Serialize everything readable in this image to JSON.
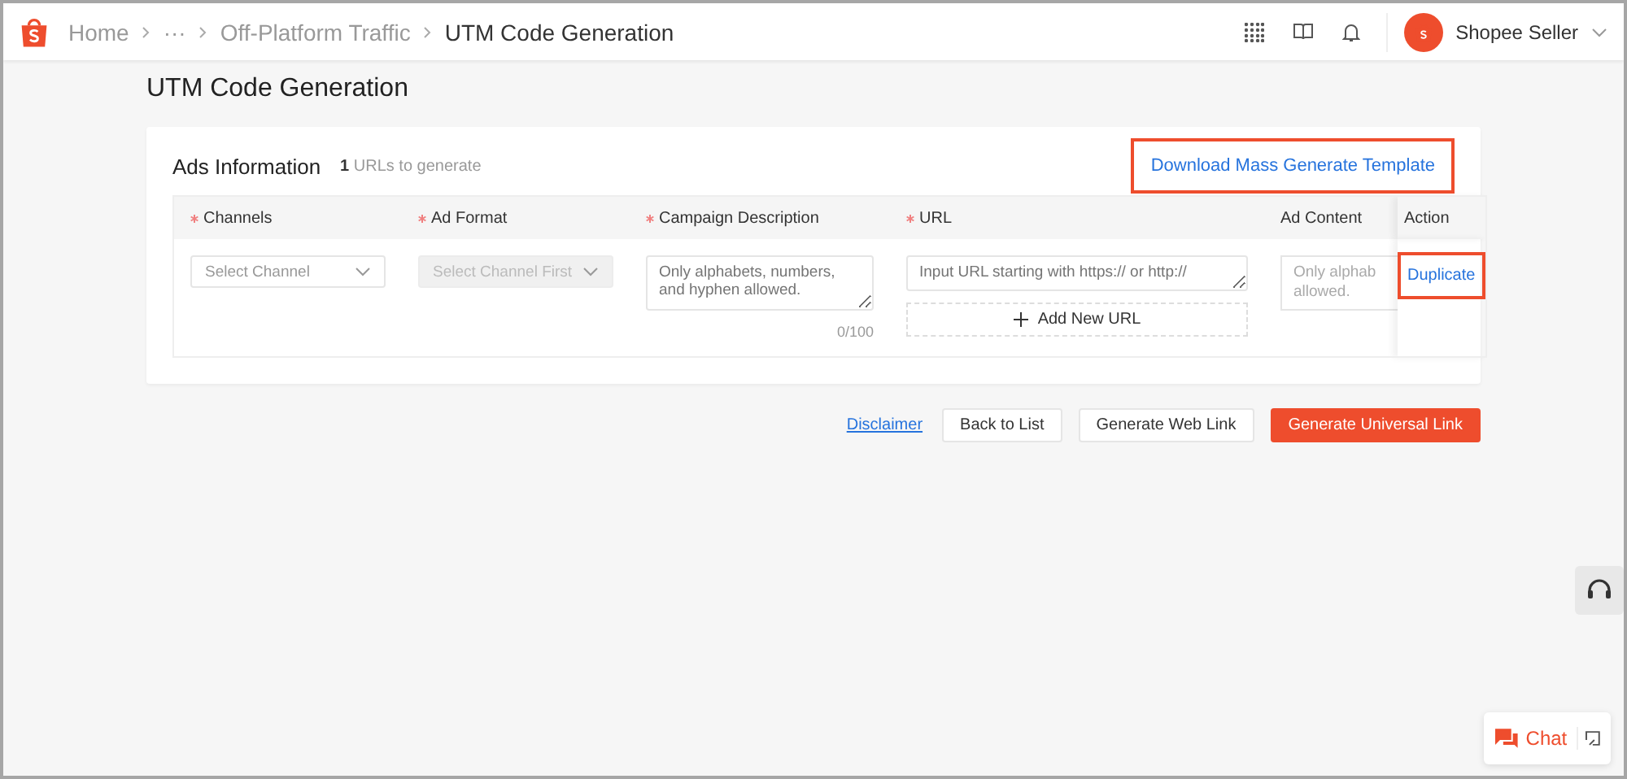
{
  "breadcrumb": [
    {
      "label": "Home",
      "current": false
    },
    {
      "label": "···",
      "current": false
    },
    {
      "label": "Off-Platform Traffic",
      "current": false
    },
    {
      "label": "UTM Code Generation",
      "current": true
    }
  ],
  "account": {
    "name": "Shopee Seller"
  },
  "page_title": "UTM Code Generation",
  "card": {
    "title": "Ads Information",
    "count": "1",
    "count_label": "URLs to generate",
    "download_link": {
      "label": "Download Mass Generate Template",
      "highlighted": true
    }
  },
  "table": {
    "columns": [
      {
        "label": "Channels",
        "required": true
      },
      {
        "label": "Ad Format",
        "required": true
      },
      {
        "label": "Campaign Description",
        "required": true
      },
      {
        "label": "URL",
        "required": true
      },
      {
        "label": "Ad Content",
        "required": false
      },
      {
        "label": "Action",
        "required": false
      }
    ],
    "row": {
      "channel": {
        "placeholder": "Select Channel"
      },
      "ad_format": {
        "placeholder": "Select Channel First",
        "disabled": true
      },
      "campaign_description": {
        "placeholder": "Only alphabets, numbers, and hyphen allowed.",
        "counter": "0/100"
      },
      "url": {
        "placeholder": "Input URL starting with https:// or http://",
        "add_button": "Add New URL"
      },
      "ad_content": {
        "placeholder_lines": [
          "Only alphab",
          "allowed."
        ]
      },
      "action": {
        "label": "Duplicate",
        "highlighted": true
      }
    }
  },
  "footer": {
    "disclaimer": "Disclaimer",
    "buttons": [
      {
        "label": "Back to List",
        "kind": "default"
      },
      {
        "label": "Generate Web Link",
        "kind": "default"
      },
      {
        "label": "Generate Universal Link",
        "kind": "primary"
      }
    ]
  },
  "chat": {
    "label": "Chat"
  }
}
